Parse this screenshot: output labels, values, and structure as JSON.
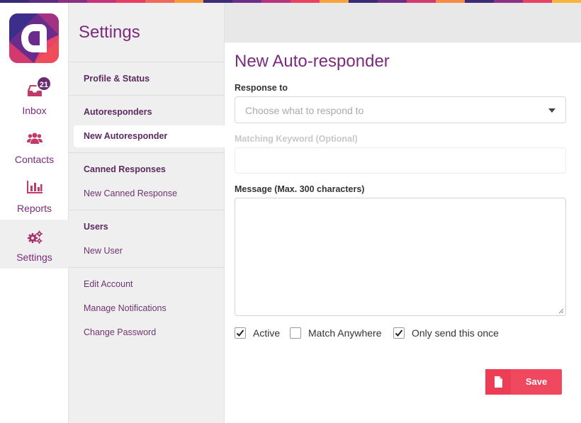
{
  "brand_colors": {
    "accent_purple": "#7b2a7c",
    "save_red": "#f0485e",
    "badge": "#6a2c70"
  },
  "nav": {
    "logo_icon": "app-logo-icon",
    "items": [
      {
        "label": "Inbox",
        "icon": "inbox-icon",
        "badge": "21"
      },
      {
        "label": "Contacts",
        "icon": "users-icon"
      },
      {
        "label": "Reports",
        "icon": "bar-chart-icon"
      },
      {
        "label": "Settings",
        "icon": "gears-icon"
      }
    ]
  },
  "settings": {
    "title": "Settings",
    "groups": [
      {
        "heading": "Profile & Status"
      },
      {
        "heading": "Autoresponders",
        "links": [
          "New Autoresponder"
        ]
      },
      {
        "heading": "Canned Responses",
        "links": [
          "New Canned Response"
        ]
      },
      {
        "heading": "Users",
        "links": [
          "New User"
        ]
      },
      {
        "links": [
          "Edit Account",
          "Manage Notifications",
          "Change Password"
        ]
      }
    ]
  },
  "form": {
    "title": "New Auto-responder",
    "response_label": "Response to",
    "response_placeholder": "Choose what to respond to",
    "keyword_label": "Matching Keyword (Optional)",
    "keyword_value": "",
    "message_label": "Message (Max. 300 characters)",
    "message_value": "",
    "checkboxes": [
      {
        "label": "Active",
        "checked": true
      },
      {
        "label": "Match Anywhere",
        "checked": false
      },
      {
        "label": "Only send this once",
        "checked": true
      }
    ],
    "save_label": "Save"
  }
}
